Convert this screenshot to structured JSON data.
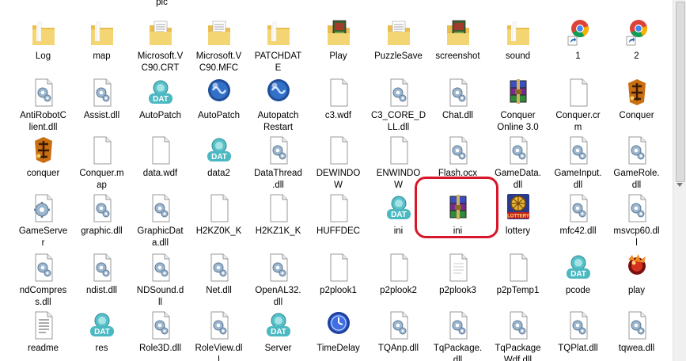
{
  "top_partial_label": "pic",
  "rows": [
    [
      {
        "label": "Log",
        "icon": "folder"
      },
      {
        "label": "map",
        "icon": "folder"
      },
      {
        "label": "Microsoft.V\nC90.CRT",
        "icon": "folder-files"
      },
      {
        "label": "Microsoft.V\nC90.MFC",
        "icon": "folder-files"
      },
      {
        "label": "PATCHDAT\nE",
        "icon": "folder"
      },
      {
        "label": "Play",
        "icon": "folder-game"
      },
      {
        "label": "PuzzleSave",
        "icon": "folder-files"
      },
      {
        "label": "screenshot",
        "icon": "folder-game"
      },
      {
        "label": "sound",
        "icon": "folder"
      },
      {
        "label": "1",
        "icon": "chrome-shortcut"
      },
      {
        "label": "2",
        "icon": "chrome-shortcut"
      }
    ],
    [
      {
        "label": "AntiRobotC\nlient.dll",
        "icon": "dll"
      },
      {
        "label": "Assist.dll",
        "icon": "dll"
      },
      {
        "label": "AutoPatch",
        "icon": "dat"
      },
      {
        "label": "AutoPatch",
        "icon": "blue-orb"
      },
      {
        "label": "Autopatch\nRestart",
        "icon": "blue-orb"
      },
      {
        "label": "c3.wdf",
        "icon": "blank"
      },
      {
        "label": "C3_CORE_D\nLL.dll",
        "icon": "dll"
      },
      {
        "label": "Chat.dll",
        "icon": "dll"
      },
      {
        "label": "Conquer\nOnline 3.0",
        "icon": "winrar"
      },
      {
        "label": "Conquer.cr\nm",
        "icon": "blank"
      },
      {
        "label": "Conquer",
        "icon": "conquer-logo"
      }
    ],
    [
      {
        "label": "conquer",
        "icon": "conquer-logo"
      },
      {
        "label": "Conquer.m\nap",
        "icon": "blank"
      },
      {
        "label": "data.wdf",
        "icon": "blank"
      },
      {
        "label": "data2",
        "icon": "dat"
      },
      {
        "label": "DataThread\n.dll",
        "icon": "dll"
      },
      {
        "label": "DEWINDO\nW",
        "icon": "blank"
      },
      {
        "label": "ENWINDO\nW",
        "icon": "blank"
      },
      {
        "label": "Flash.ocx",
        "icon": "dll"
      },
      {
        "label": "GameData.\ndll",
        "icon": "dll"
      },
      {
        "label": "GameInput.\ndll",
        "icon": "dll"
      },
      {
        "label": "GameRole.\ndll",
        "icon": "dll"
      }
    ],
    [
      {
        "label": "GameServe\nr",
        "icon": "gear"
      },
      {
        "label": "graphic.dll",
        "icon": "dll"
      },
      {
        "label": "GraphicDat\na.dll",
        "icon": "dll"
      },
      {
        "label": "H2KZ0K_K",
        "icon": "blank"
      },
      {
        "label": "H2KZ1K_K",
        "icon": "blank"
      },
      {
        "label": "HUFFDEC",
        "icon": "blank"
      },
      {
        "label": "ini",
        "icon": "dat"
      },
      {
        "label": "ini",
        "icon": "winrar"
      },
      {
        "label": "lottery",
        "icon": "lottery"
      },
      {
        "label": "mfc42.dll",
        "icon": "dll"
      },
      {
        "label": "msvcp60.dl\nl",
        "icon": "dll"
      }
    ],
    [
      {
        "label": "ndCompres\ns.dll",
        "icon": "dll"
      },
      {
        "label": "ndist.dll",
        "icon": "dll"
      },
      {
        "label": "NDSound.d\nll",
        "icon": "dll"
      },
      {
        "label": "Net.dll",
        "icon": "dll"
      },
      {
        "label": "OpenAL32.\ndll",
        "icon": "dll"
      },
      {
        "label": "p2plook1",
        "icon": "blank"
      },
      {
        "label": "p2plook2",
        "icon": "blank"
      },
      {
        "label": "p2plook3",
        "icon": "blank-lines"
      },
      {
        "label": "p2pTemp1",
        "icon": "blank"
      },
      {
        "label": "pcode",
        "icon": "dat"
      },
      {
        "label": "play",
        "icon": "play-orb"
      }
    ],
    [
      {
        "label": "readme",
        "icon": "text"
      },
      {
        "label": "res",
        "icon": "dat"
      },
      {
        "label": "Role3D.dll",
        "icon": "dll"
      },
      {
        "label": "RoleView.dl\nl",
        "icon": "dll"
      },
      {
        "label": "Server",
        "icon": "dat"
      },
      {
        "label": "TimeDelay",
        "icon": "clock"
      },
      {
        "label": "TQAnp.dll",
        "icon": "dll"
      },
      {
        "label": "TqPackage.\ndll",
        "icon": "dll"
      },
      {
        "label": "TqPackage\nWdf.dll",
        "icon": "dll"
      },
      {
        "label": "TQPlat.dll",
        "icon": "dll"
      },
      {
        "label": "tqwea.dll",
        "icon": "dll"
      }
    ]
  ],
  "dat_badge": "DAT",
  "lottery_badge": "LOTTERY",
  "colors": {
    "highlight": "#d8162a",
    "folder": "#f2cf6a",
    "selection": "none"
  }
}
